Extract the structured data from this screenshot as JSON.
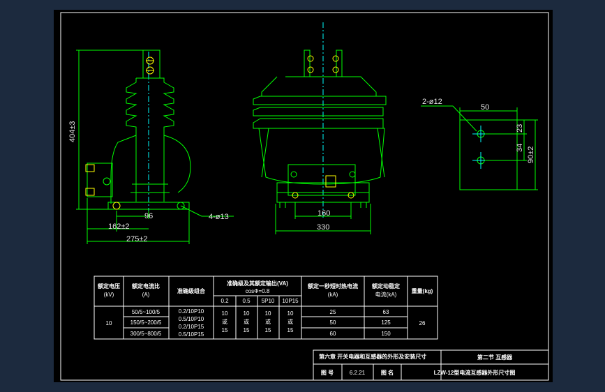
{
  "colors": {
    "background": "#1c2a3e",
    "sheet": "#000000",
    "body_line": "#00ff00",
    "dim_line": "#00ff00",
    "center_line": "#00ffff",
    "table_line": "#ffffff",
    "text": "#ffffff",
    "bolt": "#ffff00"
  },
  "side_view": {
    "height_dim": "404±3",
    "dim_96": "96",
    "dim_162": "162±2",
    "dim_275": "275±2",
    "hole_note": "4-ø13"
  },
  "front_view": {
    "dim_160": "160",
    "dim_330": "330"
  },
  "plate_view": {
    "hole_note": "2-ø12",
    "dim_50": "50",
    "dim_23": "23",
    "dim_34": "34",
    "dim_90": "90±2"
  },
  "table": {
    "headers": {
      "rated_voltage": "额定电压\n(kV)",
      "rated_ratio": "额定电流比\n(A)",
      "accuracy_combo": "准确级组合",
      "accuracy_output": "准确级及其额定输出(VA)",
      "cos_phi": "cosΦ=0.8",
      "short_time": "额定一秒短时热电流\n(kA)",
      "dynamic": "额定动稳定\n电流(kA)",
      "weight": "重量(kg)"
    },
    "sub_headers": [
      "0.2",
      "0.5",
      "5P10",
      "10P15"
    ],
    "voltage": "10",
    "ratios": [
      "50/5~100/5",
      "150/5~200/5",
      "300/5~800/5"
    ],
    "combos": [
      "0.2/10P10",
      "0.5/10P10",
      "0.2/10P15",
      "0.5/10P15"
    ],
    "out_col_top": "10",
    "out_col_mid": "或",
    "out_col_bot": "15",
    "thermal": [
      "25",
      "50",
      "60"
    ],
    "dynamic": [
      "63",
      "125",
      "150"
    ],
    "weight": "26"
  },
  "title_block": {
    "chapter": "第六章  开关电器和互感器的外形及安装尺寸",
    "section": "第二节  互感器",
    "drawing_no_label": "图  号",
    "drawing_no": "6.2.21",
    "drawing_name_label": "图  名",
    "drawing_name": "LZW-12型电流互感器外形尺寸图"
  }
}
